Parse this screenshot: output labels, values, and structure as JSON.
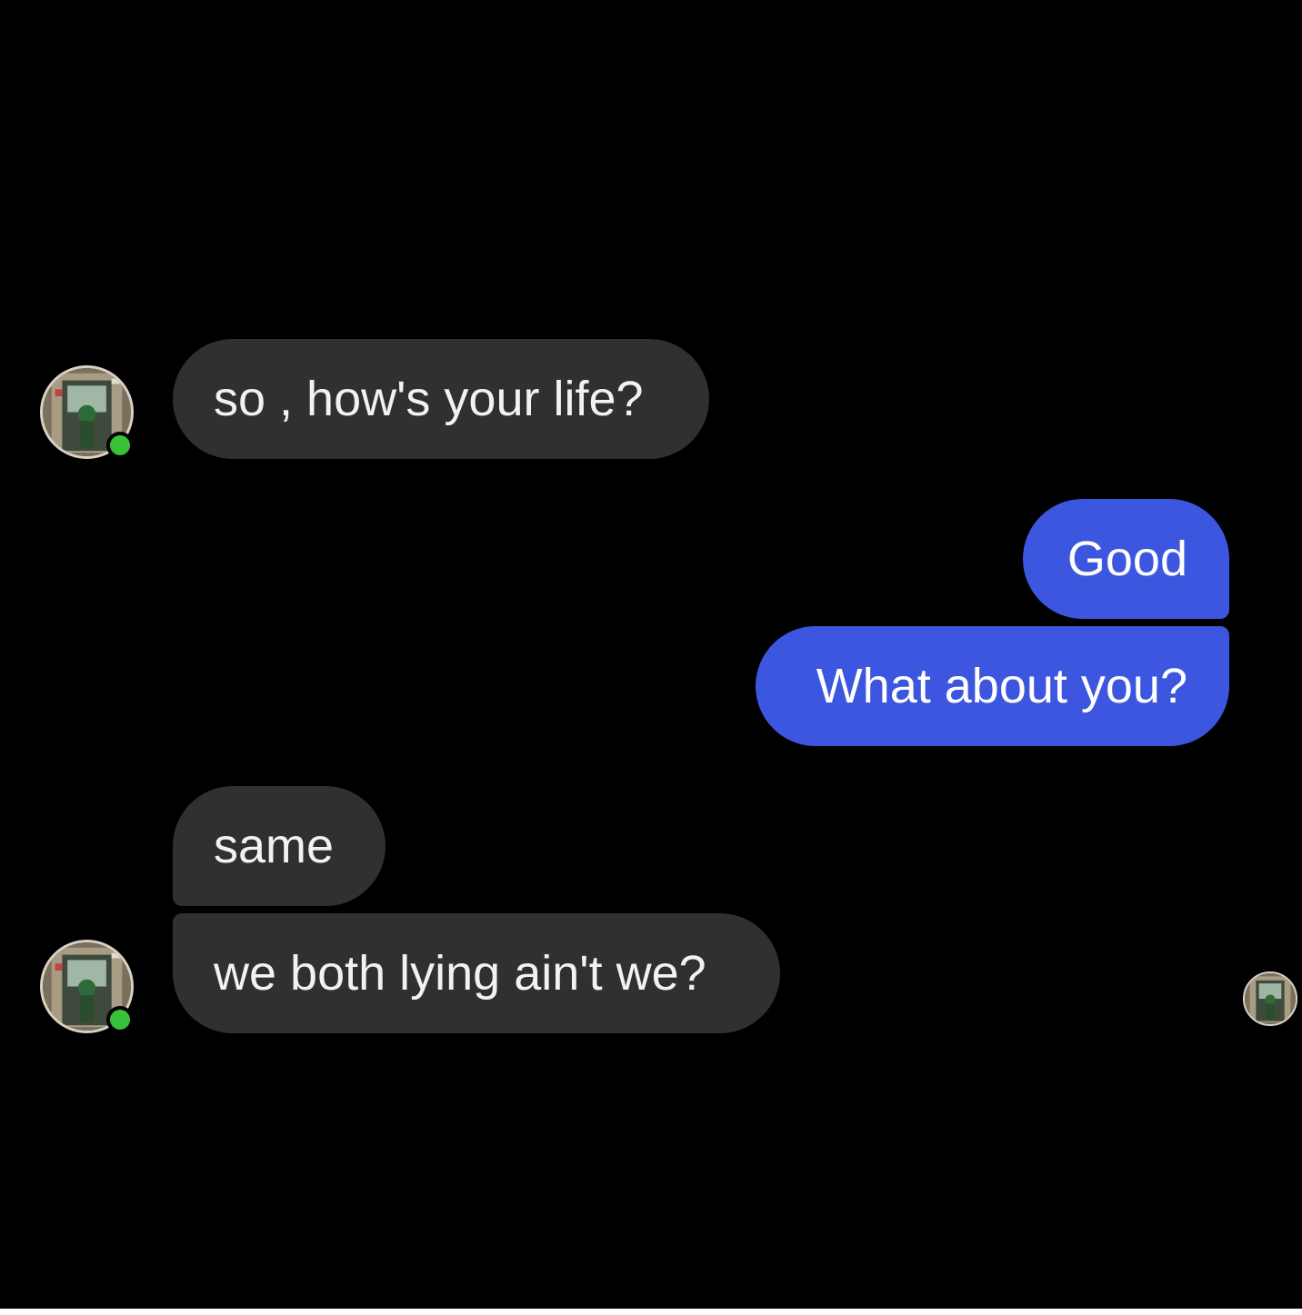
{
  "chat": {
    "messages": [
      {
        "sender": "contact",
        "text": "so , how's your life?"
      },
      {
        "sender": "me",
        "text": "Good"
      },
      {
        "sender": "me",
        "text": "What about you?"
      },
      {
        "sender": "contact",
        "text": "same"
      },
      {
        "sender": "contact",
        "text": "we both lying ain't we?"
      }
    ]
  },
  "colors": {
    "background": "#000000",
    "incoming_bubble": "#303030",
    "outgoing_bubble": "#3d56e0",
    "online_indicator": "#38c23a"
  },
  "icons": {
    "contact_avatar": "contact-avatar-photo",
    "online_status": "online-dot-icon",
    "seen_receipt": "read-receipt-avatar"
  }
}
